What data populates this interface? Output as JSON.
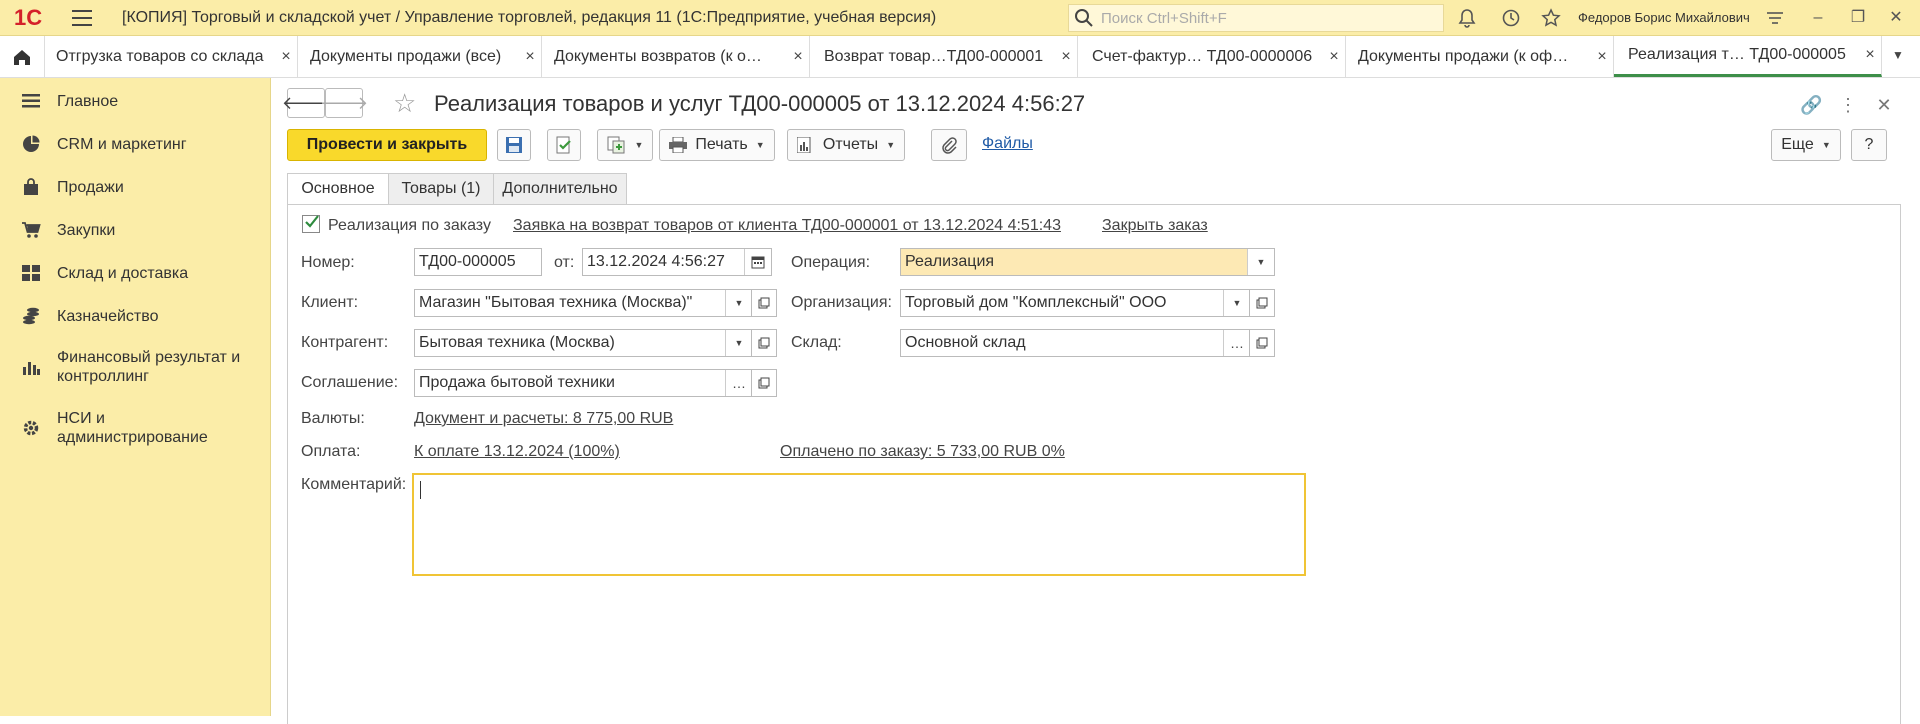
{
  "app": {
    "logo": "1С",
    "title": "[КОПИЯ] Торговый и складской учет / Управление торговлей, редакция 11  (1С:Предприятие, учебная версия)",
    "search_placeholder": "Поиск Ctrl+Shift+F",
    "user": "Федоров Борис Михайлович"
  },
  "tabs": [
    {
      "label": "Отгрузка товаров со склада",
      "close": "×"
    },
    {
      "label": "Документы продажи (все)",
      "close": "×"
    },
    {
      "label": "Документы возвратов (к о…",
      "close": "×"
    },
    {
      "label": "Возврат товар…ТД00-000001",
      "close": "×"
    },
    {
      "label": "Счет-фактур… ТД00-0000006",
      "close": "×"
    },
    {
      "label": "Документы продажи (к оф…",
      "close": "×"
    },
    {
      "label": "Реализация т… ТД00-000005",
      "close": "×"
    }
  ],
  "sidebar": {
    "items": [
      {
        "label": "Главное",
        "icon": "menu-list-icon"
      },
      {
        "label": "CRM и маркетинг",
        "icon": "pie-chart-icon"
      },
      {
        "label": "Продажи",
        "icon": "shopping-bag-icon"
      },
      {
        "label": "Закупки",
        "icon": "cart-icon"
      },
      {
        "label": "Склад и доставка",
        "icon": "warehouse-grid-icon"
      },
      {
        "label": "Казначейство",
        "icon": "coins-icon"
      },
      {
        "label": "Финансовый результат и",
        "label2": "контроллинг",
        "icon": "bar-chart-icon"
      },
      {
        "label": "НСИ и",
        "label2": "администрирование",
        "icon": "gear-icon"
      }
    ]
  },
  "document": {
    "title": "Реализация товаров и услуг ТД00-000005 от 13.12.2024 4:56:27",
    "toolbar": {
      "post_close": "Провести и закрыть",
      "print": "Печать",
      "reports": "Отчеты",
      "files": "Файлы",
      "more": "Еще",
      "help": "?"
    },
    "tabs": [
      "Основное",
      "Товары (1)",
      "Дополнительно"
    ],
    "by_order_label": "Реализация по заказу",
    "by_order_link": "Заявка на возврат товаров от клиента ТД00-000001 от 13.12.2024 4:51:43",
    "close_order": "Закрыть заказ",
    "number_label": "Номер:",
    "number": "ТД00-000005",
    "from_label": "от:",
    "date": "13.12.2024  4:56:27",
    "operation_label": "Операция:",
    "operation": "Реализация",
    "client_label": "Клиент:",
    "client": "Магазин \"Бытовая техника (Москва)\"",
    "org_label": "Организация:",
    "org": "Торговый дом \"Комплексный\" ООО",
    "contractor_label": "Контрагент:",
    "contractor": "Бытовая техника (Москва)",
    "warehouse_label": "Склад:",
    "warehouse": "Основной склад",
    "agreement_label": "Соглашение:",
    "agreement": "Продажа бытовой техники",
    "currency_label": "Валюты:",
    "currency_link": "Документ и расчеты: 8 775,00 RUB",
    "payment_label": "Оплата:",
    "payment_link": "К оплате 13.12.2024 (100%)",
    "paid_link": "Оплачено по заказу: 5 733,00 RUB 0%",
    "comment_label": "Комментарий:"
  }
}
